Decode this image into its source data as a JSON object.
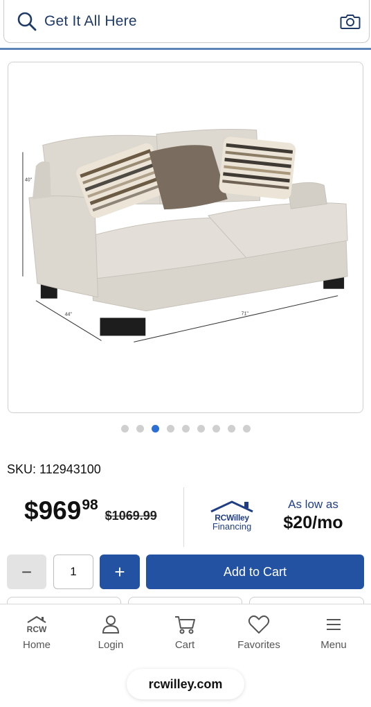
{
  "search": {
    "placeholder": "Get It All Here"
  },
  "product_image": {
    "alt_icon": "sofa-product-image",
    "dimensions": {
      "height": "40\"",
      "depth": "44\"",
      "width": "71\""
    }
  },
  "carousel": {
    "count": 9,
    "active_index": 2
  },
  "sku": {
    "text": "SKU: 112943100"
  },
  "price": {
    "dollars": "$969",
    "cents": "98",
    "original": "$1069.99"
  },
  "financing": {
    "brand": "RCWilley",
    "word": "Financing",
    "as_low_as": "As low as",
    "monthly": "$20/mo"
  },
  "quantity": {
    "minus": "−",
    "value": "1",
    "plus": "+"
  },
  "cart": {
    "add_label": "Add to Cart"
  },
  "nav": {
    "items": [
      {
        "label": "Home",
        "icon": "rcw-home-icon",
        "mark": "RCW"
      },
      {
        "label": "Login",
        "icon": "user-icon"
      },
      {
        "label": "Cart",
        "icon": "cart-icon"
      },
      {
        "label": "Favorites",
        "icon": "heart-icon"
      },
      {
        "label": "Menu",
        "icon": "hamburger-menu-icon"
      }
    ]
  },
  "browser": {
    "url": "rcwilley.com"
  },
  "colors": {
    "primary": "#2452a2",
    "navy_text": "#1f3e83",
    "active_dot": "#2b6fd6"
  }
}
